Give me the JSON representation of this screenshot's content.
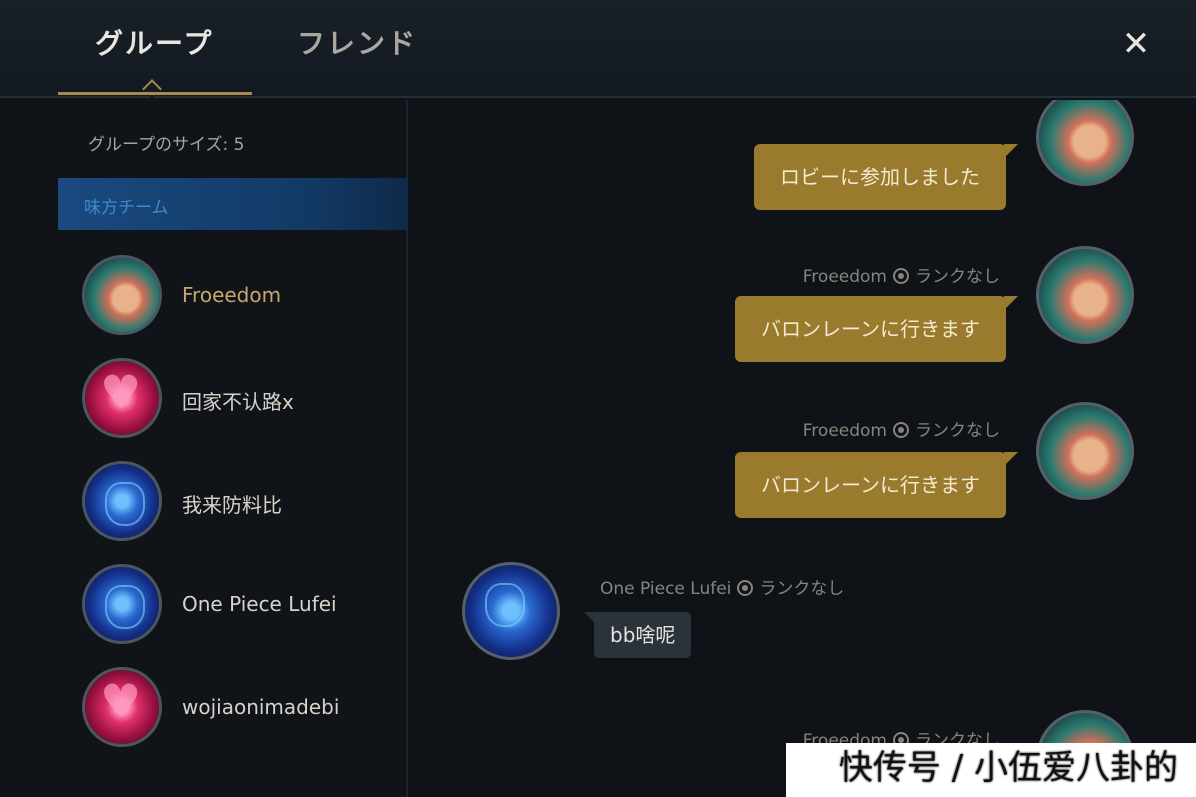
{
  "header": {
    "tabs": [
      {
        "label": "グループ",
        "active": true
      },
      {
        "label": "フレンド",
        "active": false
      }
    ],
    "close_icon": "close-icon",
    "close_glyph": "✕"
  },
  "sidebar": {
    "group_size": "グループのサイズ: 5",
    "team_label": "味方チーム",
    "members": [
      {
        "name": "Froeedom",
        "avatar": "poro-avatar"
      },
      {
        "name": "回家不认路x",
        "avatar": "heart-avatar"
      },
      {
        "name": "我来防料比",
        "avatar": "blue-avatar"
      },
      {
        "name": "One Piece Lufei",
        "avatar": "blue-avatar"
      },
      {
        "name": "wojiaonimadebi",
        "avatar": "heart-avatar"
      }
    ]
  },
  "chat": {
    "messages": [
      {
        "sender": "",
        "rank": "",
        "text": "ロビーに参加しました",
        "side": "right"
      },
      {
        "sender": "Froeedom",
        "rank": "ランクなし",
        "text": "バロンレーンに行きます",
        "side": "right"
      },
      {
        "sender": "Froeedom",
        "rank": "ランクなし",
        "text": "バロンレーンに行きます",
        "side": "right"
      },
      {
        "sender": "One Piece Lufei",
        "rank": "ランクなし",
        "text": "bb啥呢",
        "side": "left"
      },
      {
        "sender": "Froeedom",
        "rank": "ランクなし",
        "text": "",
        "side": "right"
      }
    ]
  },
  "watermark": "快传号 / 小伍爱八卦的",
  "colors": {
    "accent_gold": "#9a7b2e",
    "self_name": "#c8a76a",
    "team_bar": "#1a4a80"
  }
}
